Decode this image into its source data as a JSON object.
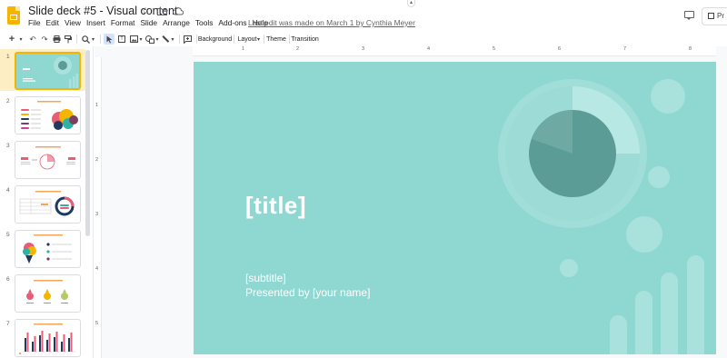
{
  "document": {
    "title": "Slide deck #5 - Visual content",
    "last_edit": "Last edit was made on March 1 by Cynthia Meyer"
  },
  "menu": [
    "File",
    "Edit",
    "View",
    "Insert",
    "Format",
    "Slide",
    "Arrange",
    "Tools",
    "Add-ons",
    "Help"
  ],
  "header_right": {
    "present_label": "Pr"
  },
  "toolbar": {
    "background": "Background",
    "layout": "Layout",
    "theme": "Theme",
    "transition": "Transition"
  },
  "ruler": {
    "top_labels": [
      "1",
      "2",
      "3",
      "4",
      "5",
      "6",
      "7",
      "8"
    ],
    "left_labels": [
      "1",
      "2",
      "3",
      "4",
      "5"
    ]
  },
  "slides": [
    {
      "number": "1",
      "title": "[title]",
      "subtitle": "[subtitle]",
      "presenter": "Presented by [your name]"
    },
    {
      "number": "2"
    },
    {
      "number": "3"
    },
    {
      "number": "4"
    },
    {
      "number": "5"
    },
    {
      "number": "6"
    },
    {
      "number": "7"
    }
  ],
  "colors": {
    "slide_bg": "#8fd8d2",
    "accent_dark": "#5b9c97",
    "selection": "#f4b400",
    "app_logo": "#f4b400"
  }
}
